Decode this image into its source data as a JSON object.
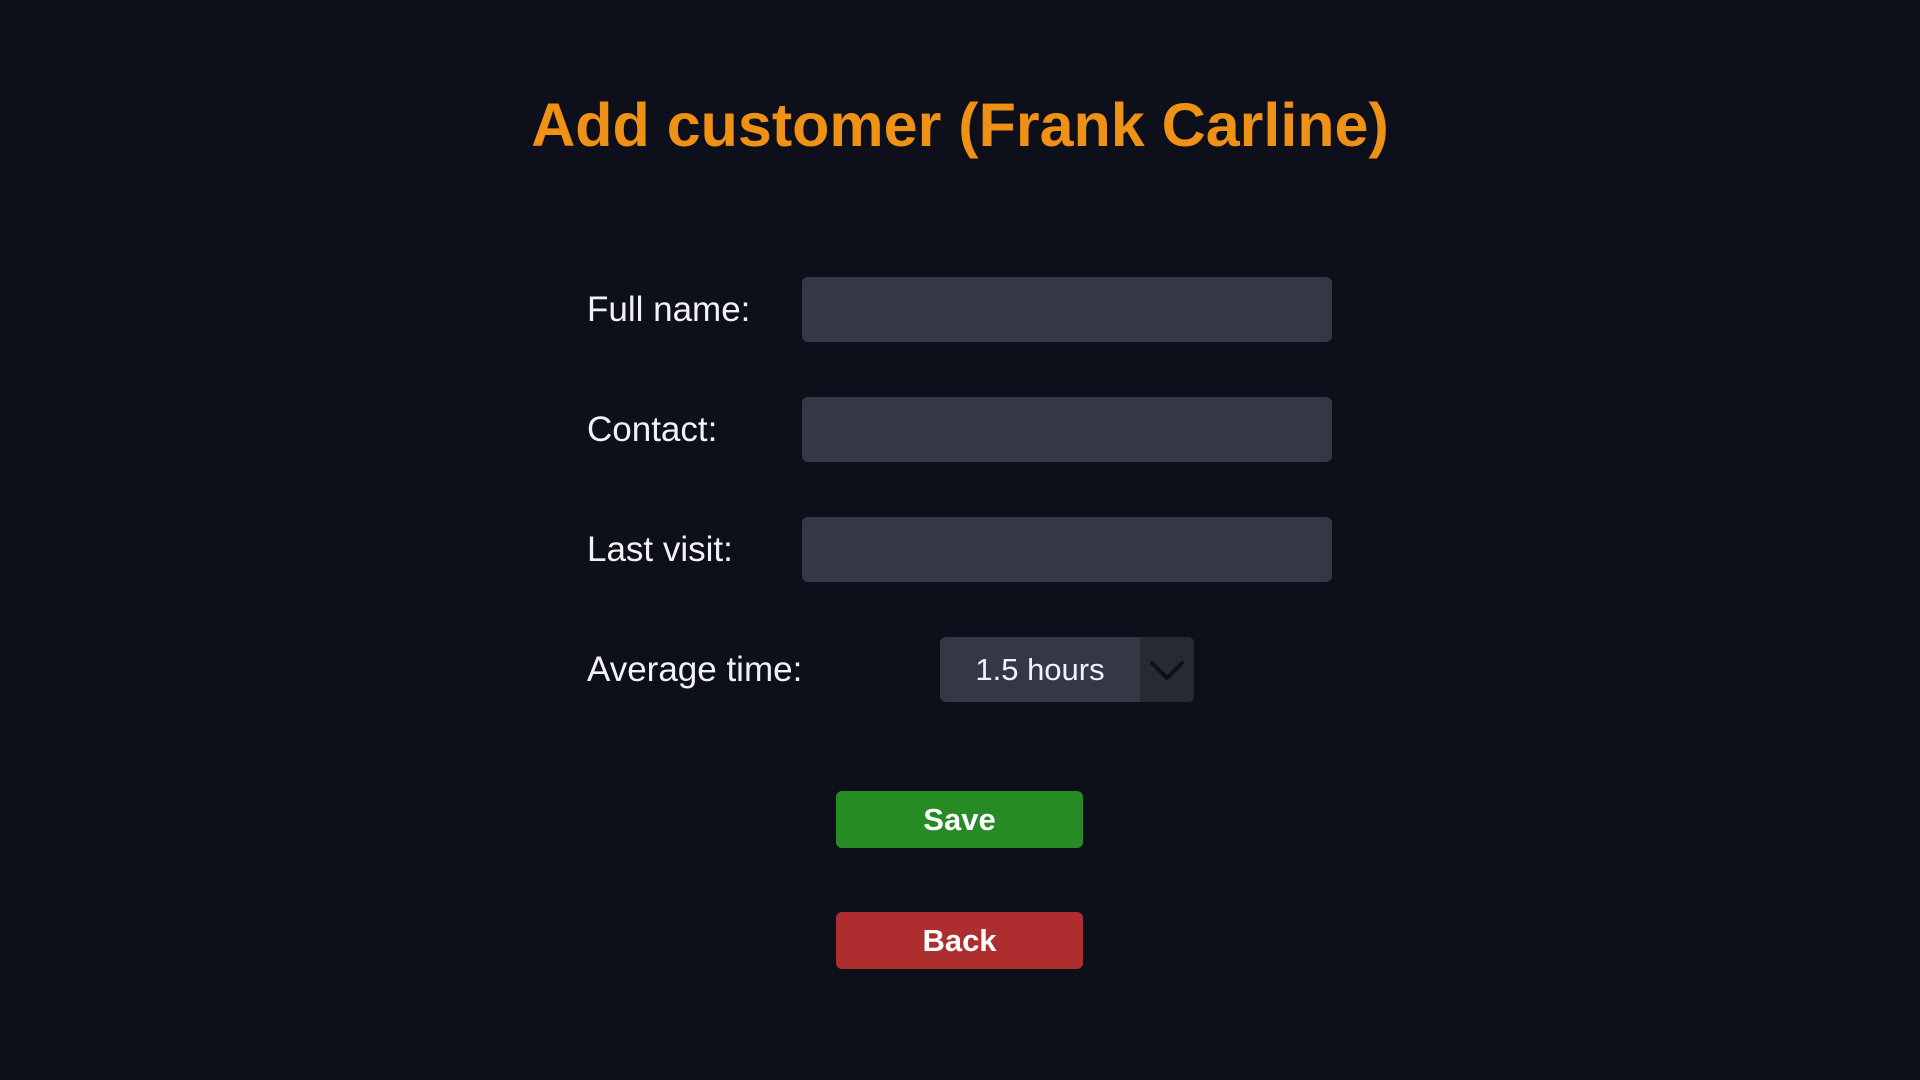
{
  "page": {
    "title": "Add customer (Frank Carline)"
  },
  "form": {
    "full_name": {
      "label": "Full name:",
      "value": "",
      "placeholder": ""
    },
    "contact": {
      "label": "Contact:",
      "value": "",
      "placeholder": ""
    },
    "last_visit": {
      "label": "Last visit:",
      "value": "",
      "placeholder": ""
    },
    "average_time": {
      "label": "Average time:",
      "selected": "1.5 hours",
      "icon": "chevron-down-icon"
    }
  },
  "buttons": {
    "save_label": "Save",
    "back_label": "Back"
  },
  "colors": {
    "background": "#0d0f1b",
    "title": "#ef9115",
    "field": "#353746",
    "save": "#268b25",
    "back": "#ae2d2f"
  }
}
